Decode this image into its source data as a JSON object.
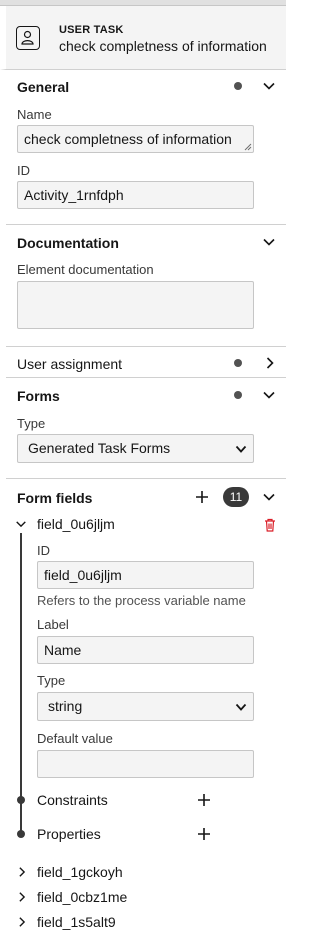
{
  "header": {
    "type_label": "USER TASK",
    "element_name": "check completness of information",
    "icon": "user-task-icon"
  },
  "groups": {
    "general": {
      "title": "General",
      "name_label": "Name",
      "name_value": "check completness of information",
      "id_label": "ID",
      "id_value": "Activity_1rnfdph"
    },
    "documentation": {
      "title": "Documentation",
      "element_doc_label": "Element documentation",
      "element_doc_value": ""
    },
    "user_assignment": {
      "title": "User assignment"
    },
    "forms": {
      "title": "Forms",
      "type_label": "Type",
      "type_value": "Generated Task Forms"
    },
    "form_fields": {
      "title": "Form fields",
      "count": "11",
      "expanded_field": {
        "name": "field_0u6jljm",
        "id_label": "ID",
        "id_value": "field_0u6jljm",
        "id_help": "Refers to the process variable name",
        "label_label": "Label",
        "label_value": "Name",
        "type_label": "Type",
        "type_value": "string",
        "default_label": "Default value",
        "default_value": "",
        "constraints_label": "Constraints",
        "properties_label": "Properties"
      },
      "collapsed_fields": [
        "field_1gckoyh",
        "field_0cbz1me",
        "field_1s5alt9"
      ]
    }
  },
  "colors": {
    "accent_dark": "#393939",
    "delete_red": "#da1e28",
    "input_bg": "#f4f4f4",
    "border": "#c6c6c6"
  }
}
